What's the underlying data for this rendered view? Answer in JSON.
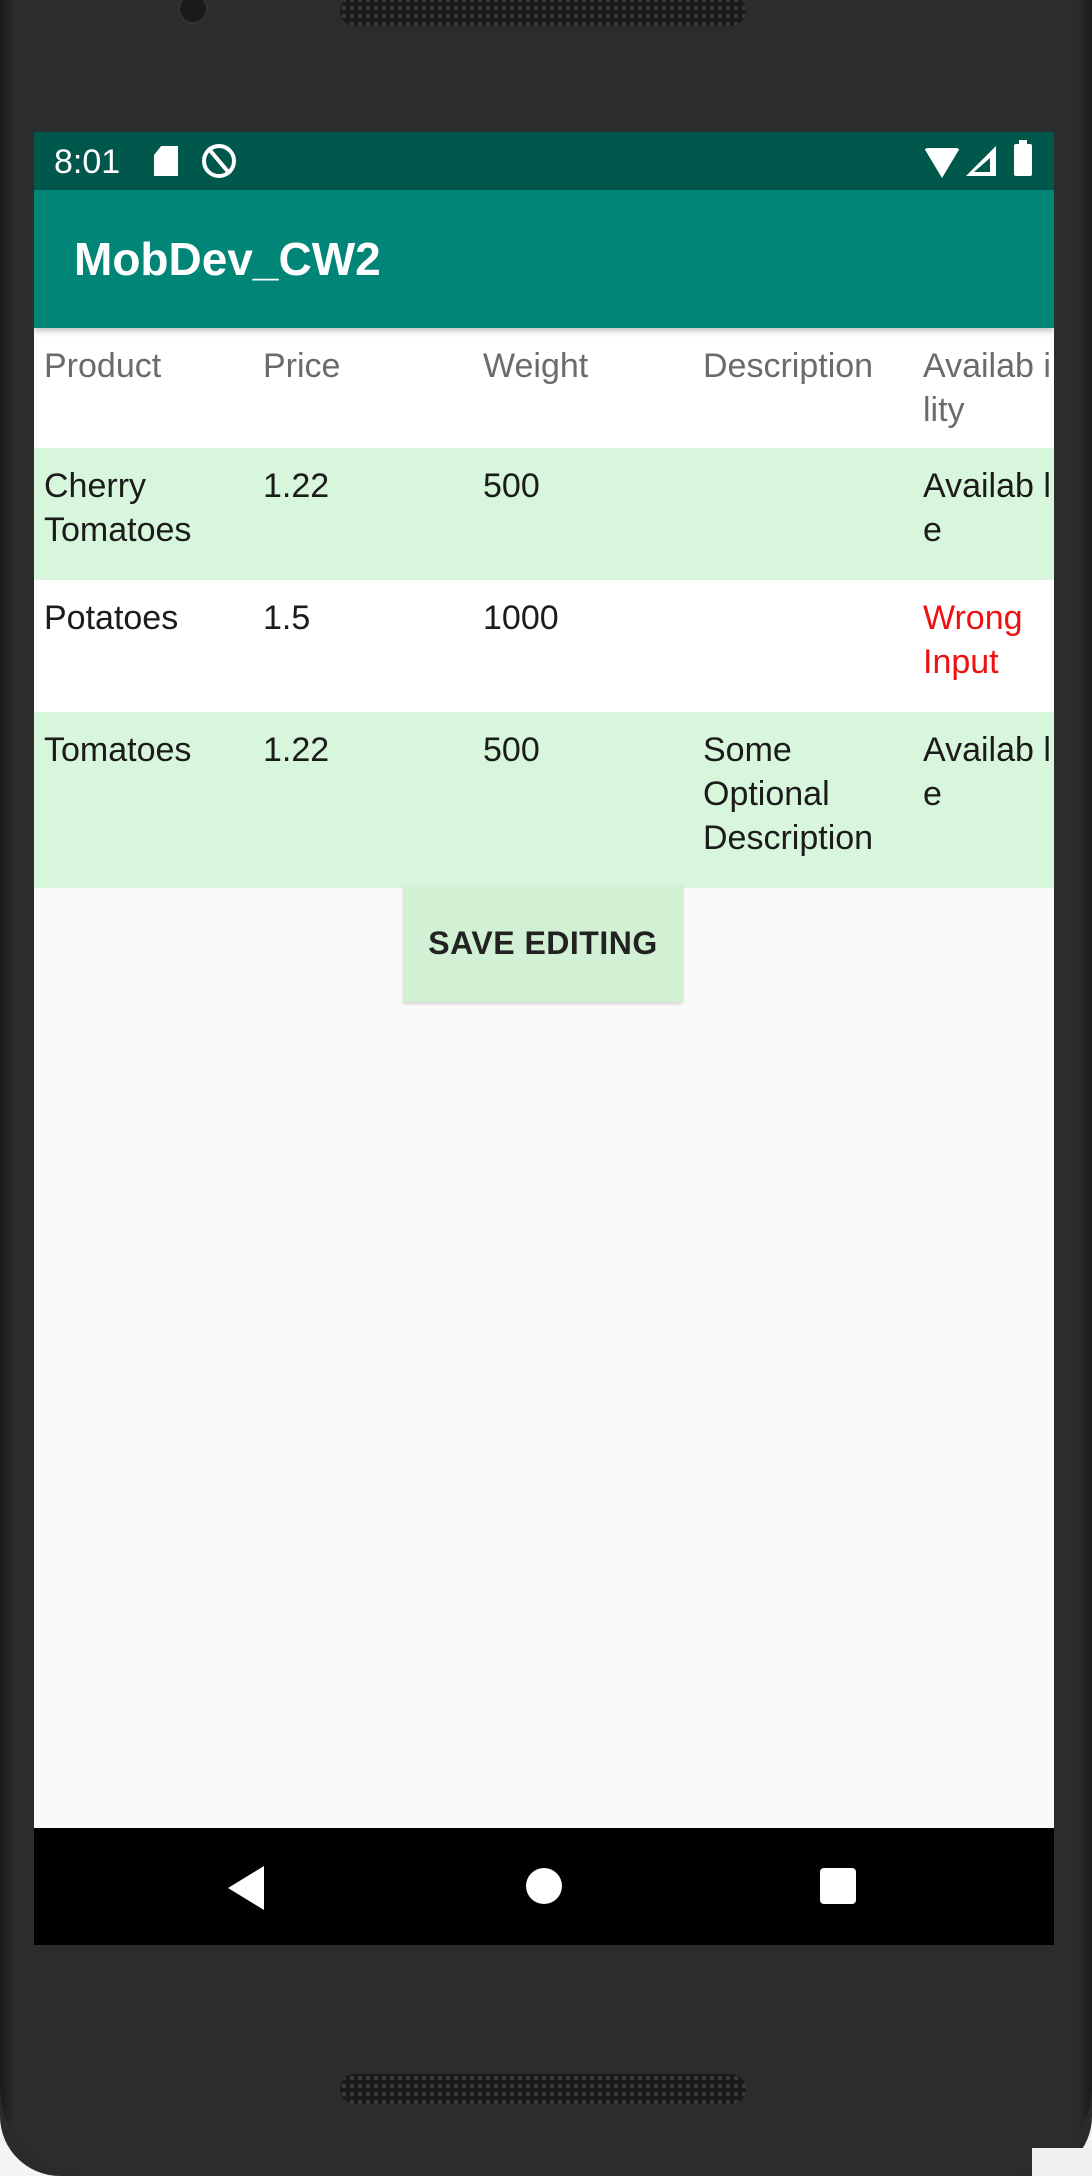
{
  "status_bar": {
    "time": "8:01",
    "icons": [
      "sd-card-icon",
      "sync-off-icon",
      "wifi-icon",
      "signal-icon",
      "battery-icon"
    ]
  },
  "app_bar": {
    "title": "MobDev_CW2"
  },
  "table": {
    "headers": [
      "Product",
      "Price",
      "Weight",
      "Description",
      "Availab ility"
    ],
    "rows": [
      {
        "product": "Cherry Tomatoes",
        "price": "1.22",
        "weight": "500",
        "description": "",
        "availability": "Availab le",
        "status": "ok"
      },
      {
        "product": "Potatoes",
        "price": "1.5",
        "weight": "1000",
        "description": "",
        "availability": "Wrong Input",
        "status": "error"
      },
      {
        "product": "Tomatoes",
        "price": "1.22",
        "weight": "500",
        "description": "Some Optional Description",
        "availability": "Availab le",
        "status": "ok"
      }
    ]
  },
  "save_button": {
    "label": "SAVE EDITING"
  },
  "colors": {
    "app_bar": "#008577",
    "status_bar": "#00574b",
    "row_highlight": "#d8f6db",
    "error_text": "#ee1111"
  },
  "nav_bar": {
    "icons": [
      "back-icon",
      "home-icon",
      "recents-icon"
    ]
  }
}
